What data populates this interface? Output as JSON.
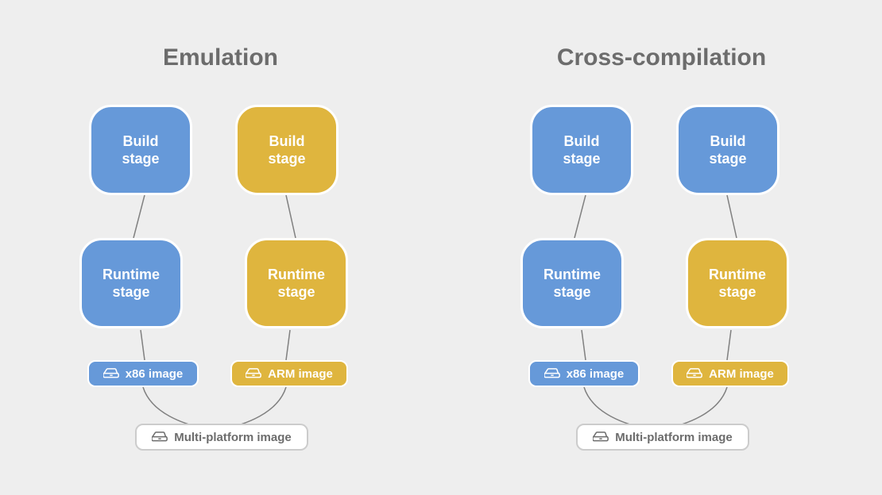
{
  "emulation": {
    "title": "Emulation",
    "build_left": "Build\nstage",
    "build_right": "Build\nstage",
    "runtime_left": "Runtime\nstage",
    "runtime_right": "Runtime\nstage",
    "image_left": "x86 image",
    "image_right": "ARM image",
    "multi": "Multi-platform image"
  },
  "cross": {
    "title": "Cross-compilation",
    "build_left": "Build\nstage",
    "build_right": "Build\nstage",
    "runtime_left": "Runtime\nstage",
    "runtime_right": "Runtime\nstage",
    "image_left": "x86 image",
    "image_right": "ARM image",
    "multi": "Multi-platform image"
  }
}
